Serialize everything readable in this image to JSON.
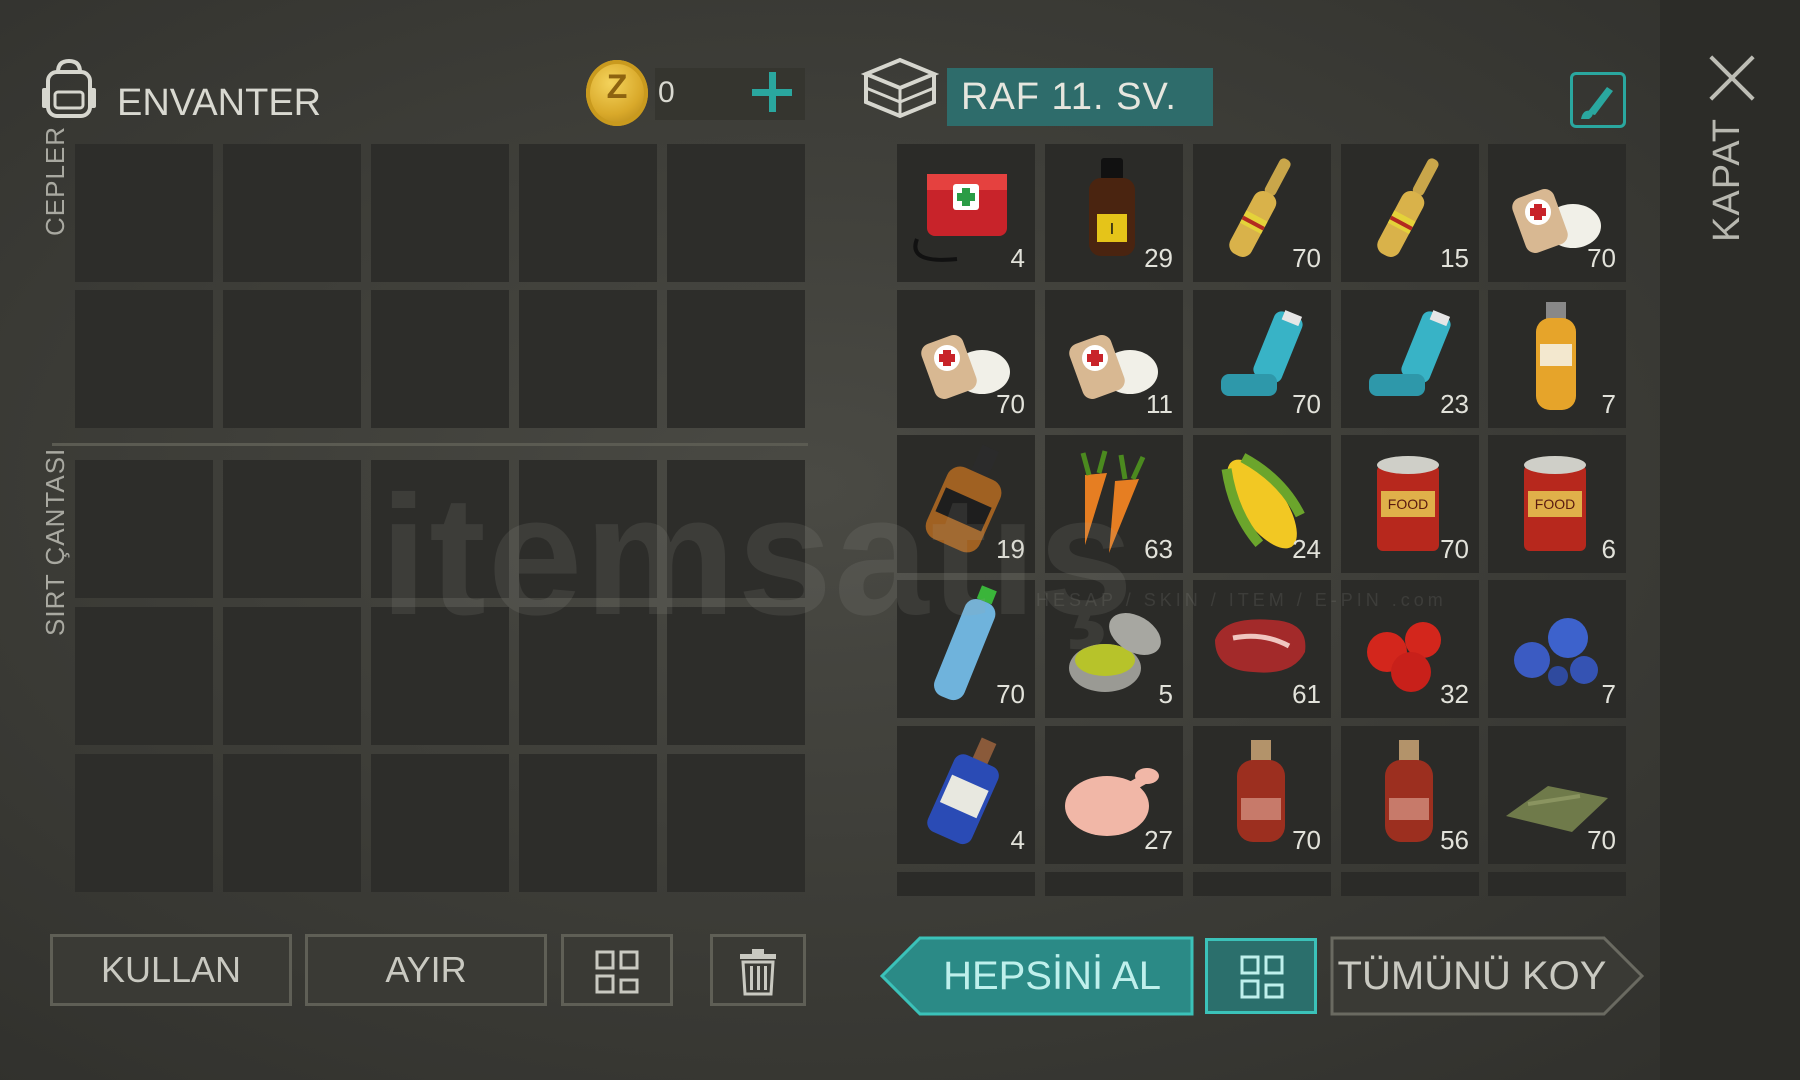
{
  "inventory": {
    "title": "ENVANTER",
    "pockets_label": "CEPLER",
    "backpack_label": "SIRT ÇANTASI"
  },
  "coins": {
    "value": "0"
  },
  "container": {
    "name": "RAF 11. SV."
  },
  "close": {
    "label": "KAPAT"
  },
  "buttons": {
    "use": "KULLAN",
    "split": "AYIR",
    "take_all": "HEPSİNİ AL",
    "put_all": "TÜMÜNÜ KOY"
  },
  "watermark": {
    "text": "itemsatış",
    "sub": "HESAP / SKIN / ITEM / E-PIN   .com"
  },
  "items": [
    {
      "name": "first-aid-kit",
      "qty": "4"
    },
    {
      "name": "iodine-bottle",
      "qty": "29"
    },
    {
      "name": "ampoule",
      "qty": "70"
    },
    {
      "name": "ampoule",
      "qty": "15"
    },
    {
      "name": "bandage",
      "qty": "70"
    },
    {
      "name": "bandage",
      "qty": "70"
    },
    {
      "name": "bandage",
      "qty": "11"
    },
    {
      "name": "inhaler",
      "qty": "70"
    },
    {
      "name": "inhaler",
      "qty": "23"
    },
    {
      "name": "pesticide-bottle",
      "qty": "7"
    },
    {
      "name": "whiskey-bottle",
      "qty": "19"
    },
    {
      "name": "carrots",
      "qty": "63"
    },
    {
      "name": "corn",
      "qty": "24"
    },
    {
      "name": "canned-food",
      "qty": "70"
    },
    {
      "name": "canned-food",
      "qty": "6"
    },
    {
      "name": "water-bottle",
      "qty": "70"
    },
    {
      "name": "ointment-tin",
      "qty": "5"
    },
    {
      "name": "raw-meat",
      "qty": "61"
    },
    {
      "name": "tomatoes",
      "qty": "32"
    },
    {
      "name": "blueberries",
      "qty": "7"
    },
    {
      "name": "blue-liquor-bottle",
      "qty": "4"
    },
    {
      "name": "raw-chicken",
      "qty": "27"
    },
    {
      "name": "spirit-bottle",
      "qty": "70"
    },
    {
      "name": "spirit-bottle",
      "qty": "56"
    },
    {
      "name": "cloth",
      "qty": "70"
    }
  ]
}
